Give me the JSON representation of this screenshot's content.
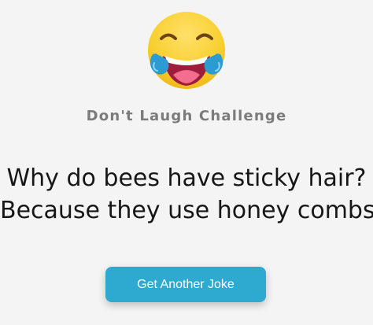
{
  "app": {
    "emoji_icon": "tears-of-joy-emoji",
    "subtitle": "Don't Laugh Challenge",
    "joke": {
      "question": "Why do bees have sticky hair?",
      "answer": "Because they use honey combs!"
    },
    "button_label": "Get Another Joke"
  },
  "colors": {
    "background": "#f4f4f4",
    "subtitle": "#7b7b7b",
    "joke_text": "#171717",
    "button": "#2ea9d0",
    "button_text": "#ffffff",
    "emoji_face": "#f6c928",
    "emoji_mouth": "#9e1d3d",
    "emoji_tongue": "#f26d8e",
    "emoji_tears": "#2b9bd1"
  }
}
